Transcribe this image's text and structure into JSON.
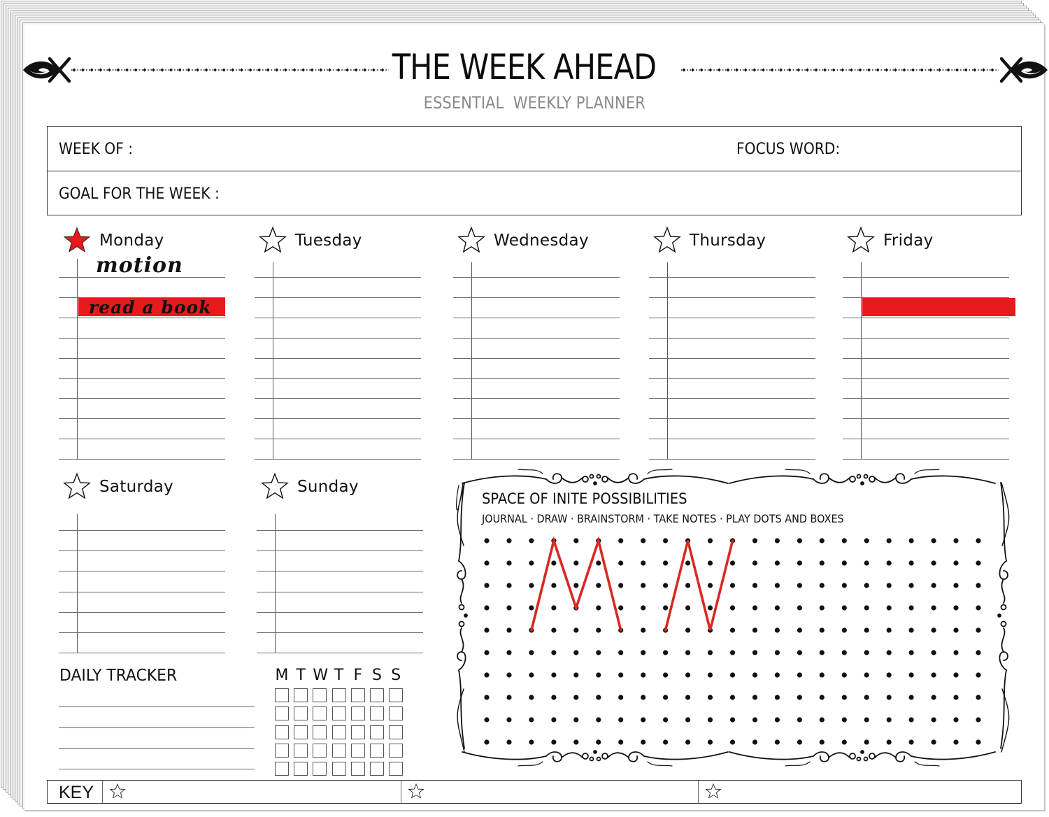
{
  "header": {
    "title": "THE WEEK AHEAD",
    "subtitle": "ESSENTIAL  WEEKLY PLANNER"
  },
  "info_box": {
    "week_of_label": "WEEK OF :",
    "week_of_value": "",
    "focus_word_label": "FOCUS WORD:",
    "focus_word_value": "",
    "goal_label": "GOAL FOR THE WEEK :",
    "goal_value": ""
  },
  "colors": {
    "accent": "#e8191b",
    "ink": "#111111",
    "subtitle_gray": "#8a8a8a",
    "rule_gray": "#6a6a6a"
  },
  "days": [
    {
      "name": "Monday",
      "starred": true,
      "lines": 10,
      "entries": [
        {
          "row": 0,
          "text": "motion",
          "highlight": false
        },
        {
          "row": 2,
          "text": "read a book",
          "highlight": true
        }
      ]
    },
    {
      "name": "Tuesday",
      "starred": false,
      "lines": 10,
      "entries": []
    },
    {
      "name": "Wednesday",
      "starred": false,
      "lines": 10,
      "entries": []
    },
    {
      "name": "Thursday",
      "starred": false,
      "lines": 10,
      "entries": []
    },
    {
      "name": "Friday",
      "starred": false,
      "lines": 10,
      "entries": [
        {
          "row": 2,
          "text": "",
          "highlight": true
        }
      ]
    },
    {
      "name": "Saturday",
      "starred": false,
      "lines": 7,
      "entries": []
    },
    {
      "name": "Sunday",
      "starred": false,
      "lines": 7,
      "entries": []
    }
  ],
  "tracker": {
    "title": "DAILY TRACKER",
    "day_letters": [
      "M",
      "T",
      "W",
      "T",
      "F",
      "S",
      "S"
    ],
    "habits": [
      "",
      "",
      "",
      ""
    ],
    "checkbox_rows": 5
  },
  "possibilities": {
    "title": "SPACE OF INITE POSSIBILITIES",
    "subtitle": "JOURNAL · DRAW · BRAINSTORM · TAKE NOTES · PLAY DOTS AND BOXES",
    "grid": {
      "columns": 23,
      "rows": 10
    },
    "drawings": [
      {
        "letter": "M",
        "points": [
          [
            2,
            4
          ],
          [
            3,
            0
          ],
          [
            4,
            3
          ],
          [
            5,
            0
          ],
          [
            6,
            4
          ]
        ]
      },
      {
        "letter": "N",
        "points": [
          [
            8,
            4
          ],
          [
            9,
            0
          ],
          [
            10,
            4
          ],
          [
            11,
            0
          ]
        ]
      }
    ]
  },
  "key": {
    "label": "KEY",
    "items": [
      "",
      "",
      ""
    ]
  }
}
